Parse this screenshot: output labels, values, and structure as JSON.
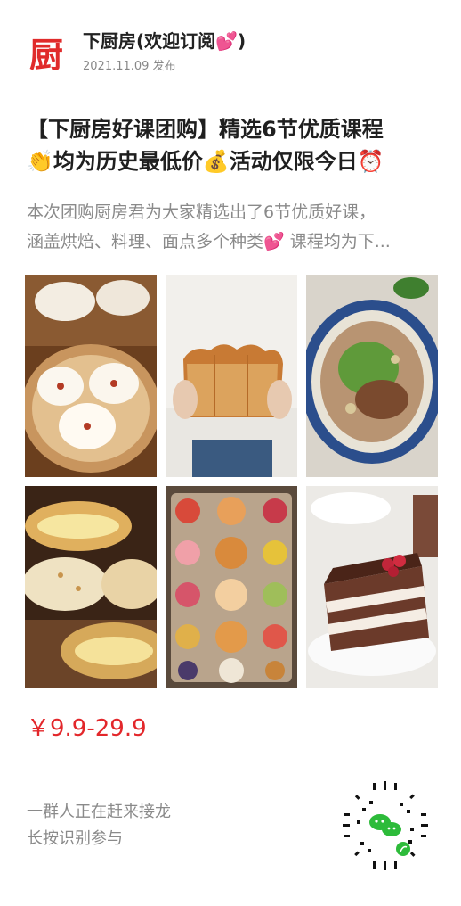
{
  "header": {
    "logo_text": "厨",
    "account_name": "下厨房(欢迎订阅💕)",
    "publish_date": "2021.11.09 发布"
  },
  "post": {
    "title_lines": [
      "【下厨房好课团购】精选6节优质课程",
      "👏均为历史最低价💰活动仅限今日⏰"
    ],
    "summary_lines": [
      "本次团购厨房君为大家精选出了6节优质好课，",
      "涵盖烘焙、料理、面点多个种类💕 课程均为下..."
    ]
  },
  "gallery": {
    "images": [
      {
        "icon": "steamed-buns-image"
      },
      {
        "icon": "bread-loaf-image"
      },
      {
        "icon": "beef-noodle-bowl-image"
      },
      {
        "icon": "cream-buns-image"
      },
      {
        "icon": "pastry-tray-image"
      },
      {
        "icon": "chocolate-cake-image"
      }
    ]
  },
  "price": "￥9.9-29.9",
  "cta": {
    "line1": "一群人正在赶来接龙",
    "line2": "长按识别参与"
  },
  "qr": {
    "icon": "mini-program-code-icon"
  },
  "colors": {
    "brand_red": "#e02b2b",
    "price_red": "#e3272b",
    "muted_text": "#8a8a8a"
  }
}
